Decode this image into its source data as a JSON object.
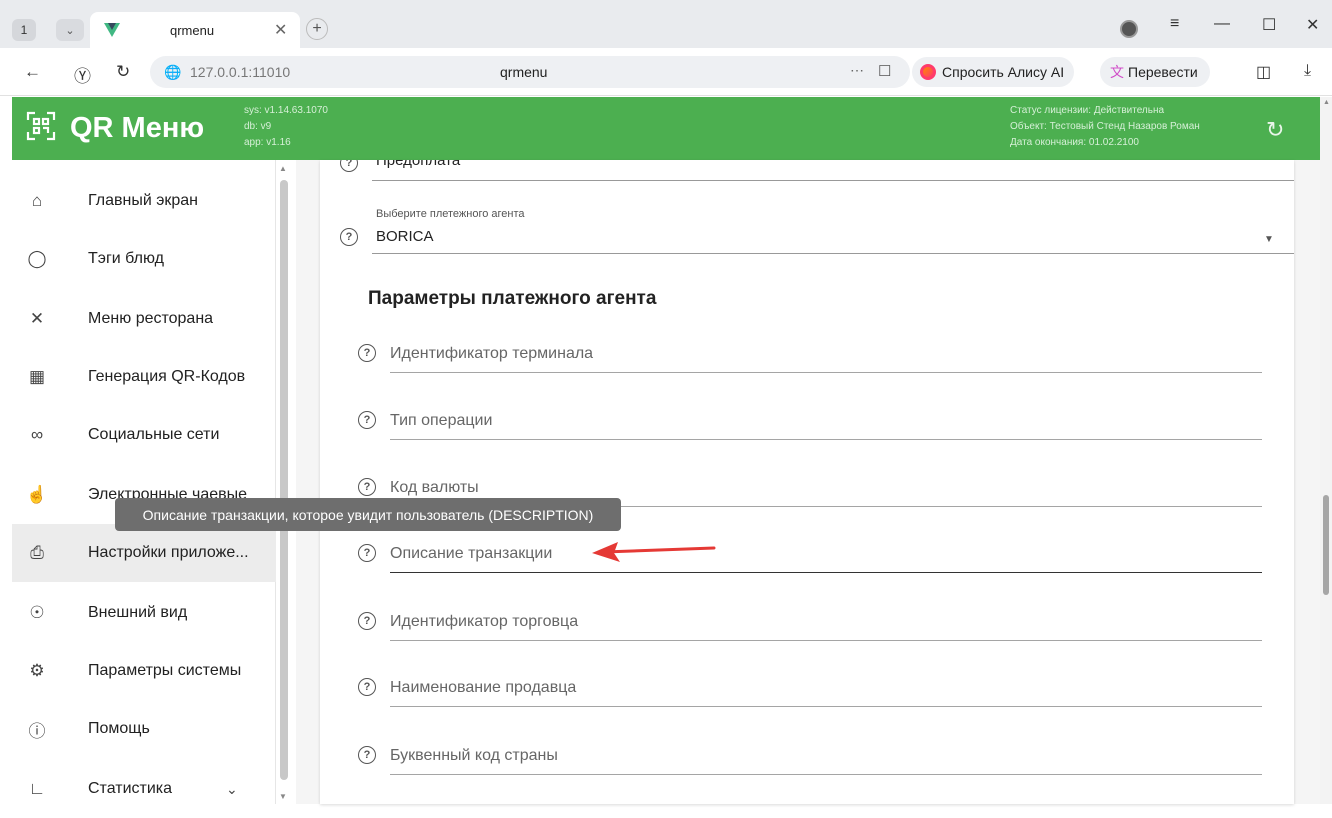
{
  "browser": {
    "tab_count": "1",
    "tab_title": "qrmenu",
    "url": "127.0.0.1:11010",
    "page_title": "qrmenu",
    "alice_label": "Спросить Алису AI",
    "translate_label": "Перевести"
  },
  "header": {
    "logo_text": "QR Меню",
    "sys_version": "sys: v1.14.63.1070",
    "db_version": "db: v9",
    "app_version": "app: v1.16",
    "license_status": "Статус лицензии: Действительна",
    "license_object": "Объект: Тестовый Стенд Назаров Роман",
    "license_expiry": "Дата окончания: 01.02.2100"
  },
  "sidebar": {
    "items": [
      {
        "label": "Главный экран",
        "icon": "home-icon"
      },
      {
        "label": "Тэги блюд",
        "icon": "tag-icon"
      },
      {
        "label": "Меню ресторана",
        "icon": "cutlery-icon"
      },
      {
        "label": "Генерация QR-Кодов",
        "icon": "qr-icon"
      },
      {
        "label": "Социальные сети",
        "icon": "link-icon"
      },
      {
        "label": "Электронные чаевые",
        "icon": "tips-icon"
      },
      {
        "label": "Настройки приложе...",
        "icon": "settings-app-icon"
      },
      {
        "label": "Внешний вид",
        "icon": "eye-icon"
      },
      {
        "label": "Параметры системы",
        "icon": "gear-icon"
      },
      {
        "label": "Помощь",
        "icon": "help-icon"
      },
      {
        "label": "Статистика",
        "icon": "chart-icon"
      }
    ]
  },
  "form": {
    "prepay_value": "Предоплата",
    "agent_label": "Выберите плетежного агента",
    "agent_value": "BORICA",
    "section_title": "Параметры платежного агента",
    "fields": [
      "Идентификатор терминала",
      "Тип операции",
      "Код валюты",
      "Описание транзакции",
      "Идентификатор торговца",
      "Наименование продавца",
      "Буквенный код страны"
    ],
    "tooltip": "Описание транзакции, которое увидит пользователь (DESCRIPTION)"
  },
  "colors": {
    "header_green": "#4caf50",
    "arrow_red": "#e53935"
  }
}
